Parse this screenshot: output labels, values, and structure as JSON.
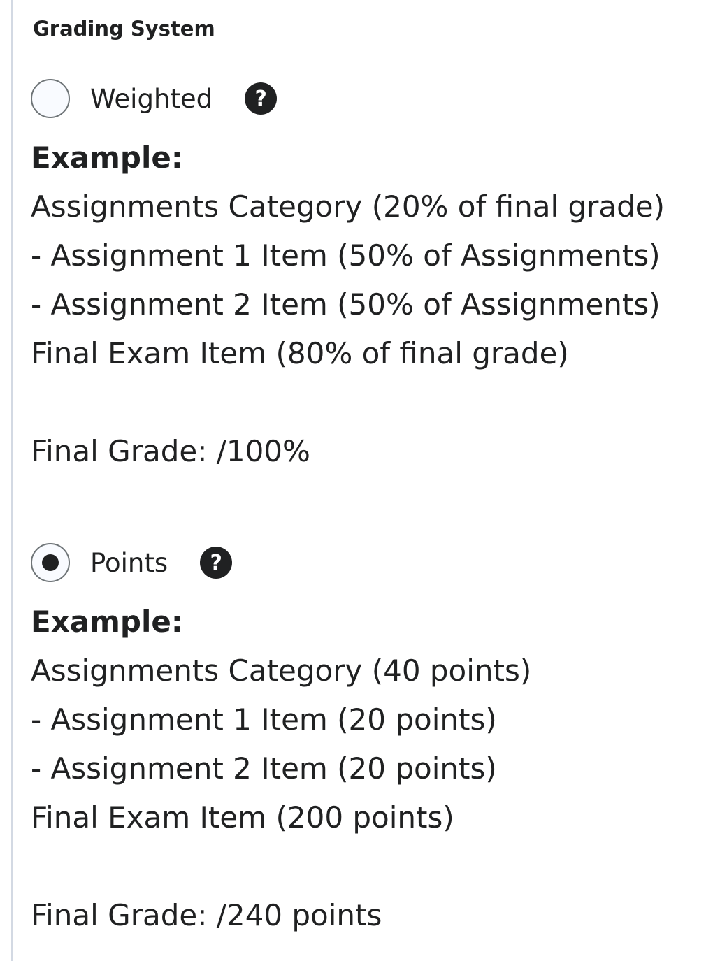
{
  "grading_system": {
    "title": "Grading System",
    "options": [
      {
        "label": "Weighted",
        "selected": false,
        "help_icon": "question-circle-icon",
        "example_heading": "Example:",
        "example_lines": [
          "Assignments Category (20% of final grade)",
          "- Assignment 1 Item (50% of Assignments)",
          "- Assignment 2 Item (50% of Assignments)",
          "Final Exam Item (80% of final grade)"
        ],
        "final_grade": "Final Grade: /100%"
      },
      {
        "label": "Points",
        "selected": true,
        "help_icon": "question-circle-icon",
        "example_heading": "Example:",
        "example_lines": [
          "Assignments Category (40 points)",
          "- Assignment 1 Item (20 points)",
          "- Assignment 2 Item (20 points)",
          "Final Exam Item (200 points)"
        ],
        "final_grade": "Final Grade: /240 points"
      }
    ]
  }
}
